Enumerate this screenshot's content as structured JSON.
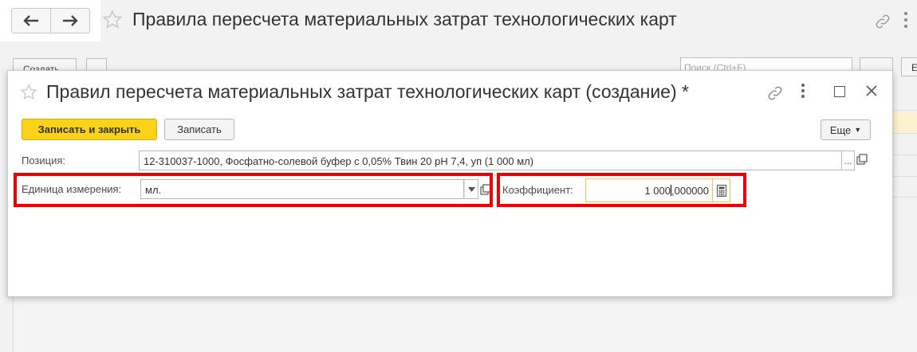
{
  "main": {
    "title": "Правила пересчета материальных затрат технологических карт",
    "create_label": "Создать",
    "search_placeholder": "Поиск (Ctrl+F)",
    "e_label": "Е"
  },
  "dialog": {
    "title": "Правил пересчета материальных затрат технологических карт (создание) *",
    "buttons": {
      "save_close": "Записать и закрыть",
      "save": "Записать",
      "more": "Еще"
    },
    "fields": {
      "position_label": "Позиция:",
      "position_value": "12-310037-1000, Фосфатно-солевой буфер с 0,05% Твин 20 pH 7,4, уп (1 000 мл)",
      "position_dots": "...",
      "unit_label": "Единица измерения:",
      "unit_value": "мл.",
      "coef_label": "Коэффициент:",
      "coef_value_int": "1 000",
      "coef_value_frac": ",000000"
    }
  },
  "colors": {
    "primary_button": "#fbd21a",
    "highlight_box": "#ee0000",
    "active_field_border": "#f0c44a"
  }
}
